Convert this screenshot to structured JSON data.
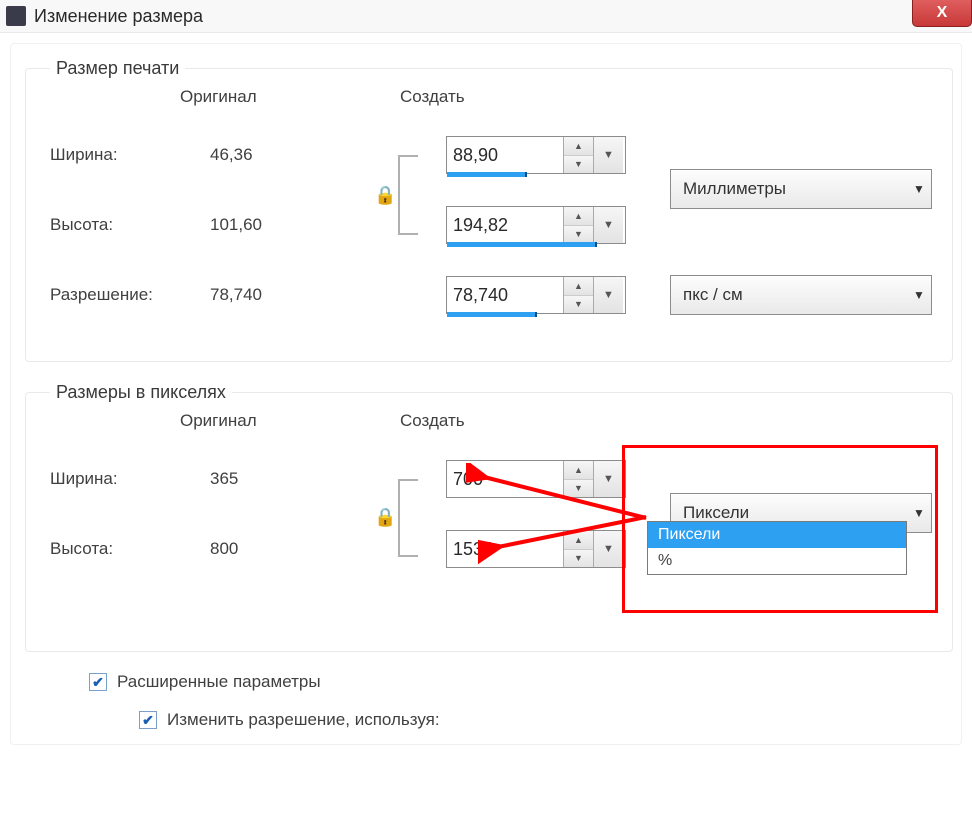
{
  "window": {
    "title": "Изменение размера",
    "close_x": "X"
  },
  "print": {
    "legend": "Размер печати",
    "col_orig": "Оригинал",
    "col_new": "Создать",
    "width_label": "Ширина:",
    "width_orig": "46,36",
    "width_new": "88,90",
    "height_label": "Высота:",
    "height_orig": "101,60",
    "height_new": "194,82",
    "res_label": "Разрешение:",
    "res_orig": "78,740",
    "res_new": "78,740",
    "units": "Миллиметры",
    "res_units": "пкс / см"
  },
  "pixels": {
    "legend": "Размеры в пикселях",
    "col_orig": "Оригинал",
    "col_new": "Создать",
    "width_label": "Ширина:",
    "width_orig": "365",
    "width_new": "700",
    "height_label": "Высота:",
    "height_orig": "800",
    "height_new": "1534",
    "units_selected": "Пиксели",
    "options": {
      "o1": "Пиксели",
      "o2": "%"
    }
  },
  "advanced_label": "Расширенные параметры",
  "change_res_label": "Изменить разрешение, используя:"
}
